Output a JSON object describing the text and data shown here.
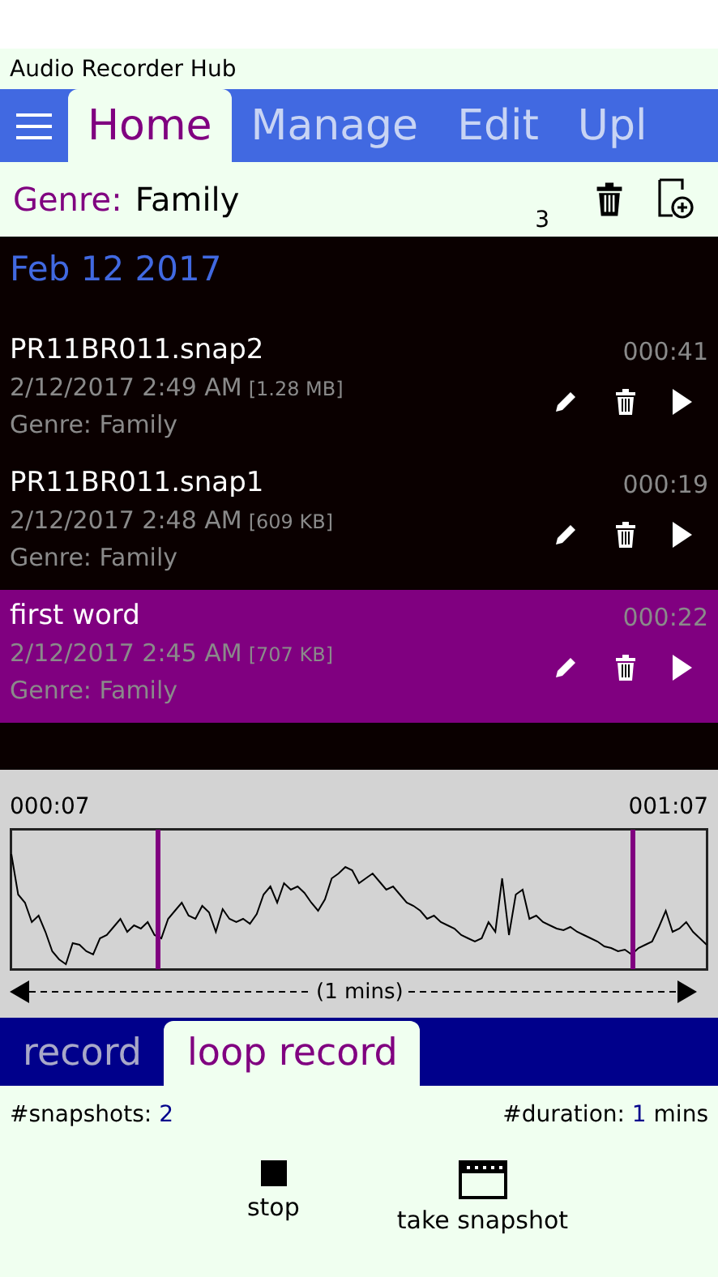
{
  "window": {
    "title": "Audio Recorder Hub"
  },
  "tabs": [
    {
      "label": "Home",
      "selected": true
    },
    {
      "label": "Manage",
      "selected": false
    },
    {
      "label": "Edit",
      "selected": false
    },
    {
      "label": "Upl",
      "selected": false
    }
  ],
  "genre_bar": {
    "label": "Genre:",
    "value": "Family",
    "count": "3"
  },
  "list": {
    "group": "Feb 12 2017",
    "items": [
      {
        "title": "PR11BR011.snap2",
        "date": "2/12/2017 2:49 AM",
        "size": "[1.28 MB]",
        "genre": "Genre: Family",
        "duration": "000:41",
        "selected": false
      },
      {
        "title": "PR11BR011.snap1",
        "date": "2/12/2017 2:48 AM",
        "size": "[609 KB]",
        "genre": "Genre: Family",
        "duration": "000:19",
        "selected": false
      },
      {
        "title": "first word",
        "date": "2/12/2017 2:45 AM",
        "size": "[707 KB]",
        "genre": "Genre: Family",
        "duration": "000:22",
        "selected": true
      }
    ]
  },
  "waveform": {
    "start": "000:07",
    "end": "001:07",
    "span": "(1 mins)"
  },
  "mode_tabs": [
    {
      "label": "record",
      "selected": false
    },
    {
      "label": "loop record",
      "selected": true
    }
  ],
  "stats": {
    "snapshots_label": "#snapshots:",
    "snapshots": "2",
    "duration_label": "#duration:",
    "duration": "1",
    "duration_unit": "mins"
  },
  "actions": [
    {
      "kind": "stop",
      "label": "stop"
    },
    {
      "kind": "snapshot",
      "label": "take snapshot"
    }
  ]
}
